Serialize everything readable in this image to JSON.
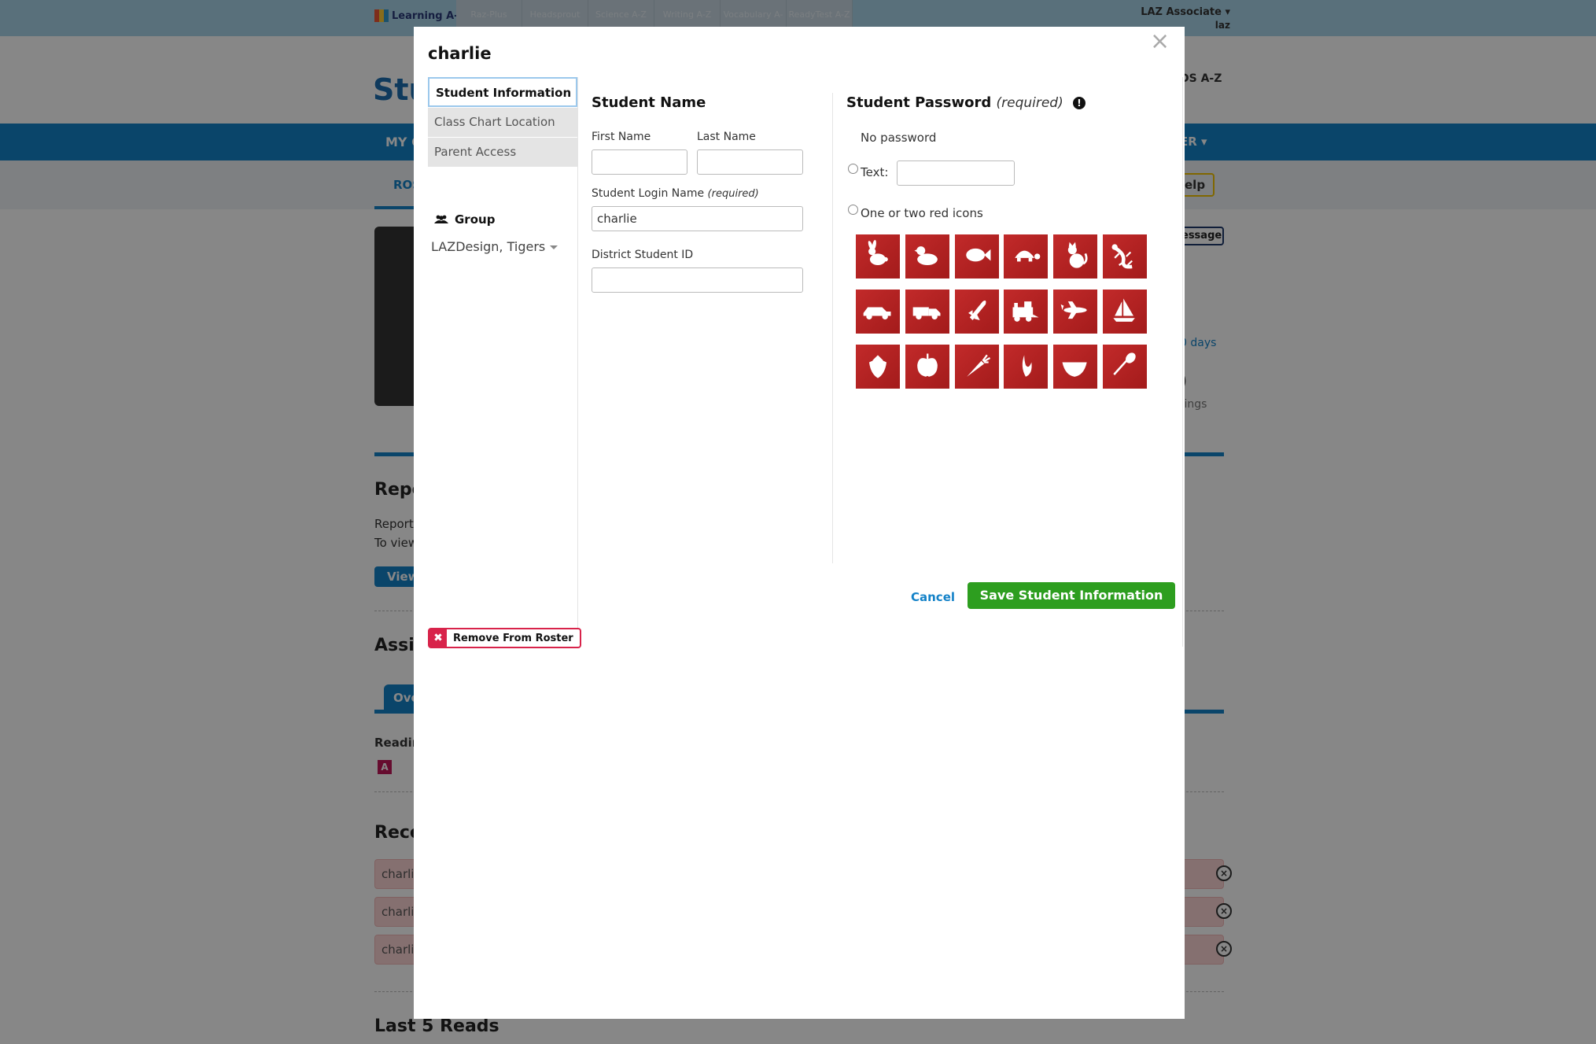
{
  "background": {
    "brand_logo": "Learning A-Z",
    "products": [
      "Raz-Plus",
      "Headsprout",
      "Science A-Z",
      "Writing A-Z",
      "Vocabulary A-Z",
      "ReadyTest A-Z"
    ],
    "user": {
      "name": "LAZ Associate",
      "sub": "laz"
    },
    "brand_partial": "Stu",
    "kids_partial": "DS A-Z",
    "nav_left_partial": "MY C",
    "nav_right_partial": "ER",
    "subnav_partial": "ROS",
    "help_partial": "elp",
    "message_partial": "essage",
    "stat_a_partial": "0 days",
    "stat_b_partial": ")",
    "stat_c_partial": "tings",
    "reports_title_partial": "Repo",
    "reports_text_1_partial": "Report",
    "reports_text_2_partial": "To view",
    "view_button_partial": "View",
    "assign_title_partial": "Assig",
    "overview_tab_partial": "Ove",
    "reading_label_partial": "Readir",
    "reading_level": "A",
    "recent_title_partial": "Rece",
    "recent_rows": [
      "charli",
      "charli",
      "charli"
    ],
    "last_reads_title": "Last 5 Reads"
  },
  "modal": {
    "title": "charlie",
    "close_label": "×",
    "tabs": [
      {
        "label": "Student Information",
        "active": true
      },
      {
        "label": "Class Chart Location",
        "active": false
      },
      {
        "label": "Parent Access",
        "active": false
      }
    ],
    "group": {
      "header": "Group",
      "value": "LAZDesign, Tigers"
    },
    "student_name": {
      "header": "Student Name",
      "first_name_label": "First Name",
      "first_name_value": "",
      "last_name_label": "Last Name",
      "last_name_value": "",
      "login_label": "Student Login Name",
      "login_required": "(required)",
      "login_value": "charlie",
      "district_id_label": "District Student ID",
      "district_id_value": ""
    },
    "password": {
      "header": "Student Password",
      "required": "(required)",
      "info_icon": "!",
      "no_password": "No password",
      "text_option": "Text:",
      "text_value": "",
      "icons_option": "One or two red icons",
      "icons": [
        "rabbit-icon",
        "duck-icon",
        "fish-icon",
        "turtle-icon",
        "cat-icon",
        "lizard-icon",
        "car-icon",
        "truck-icon",
        "rocket-icon",
        "train-icon",
        "airplane-icon",
        "sailboat-icon",
        "strawberry-icon",
        "apple-icon",
        "carrot-icon",
        "banana-icon",
        "watermelon-icon",
        "spoon-icon"
      ],
      "tile_color": "#b82222"
    },
    "cancel_label": "Cancel",
    "save_label": "Save Student Information",
    "remove_label": "Remove From Roster",
    "remove_icon": "✖"
  },
  "colors": {
    "accent_blue": "#1482c8",
    "save_green": "#2d9e1f",
    "remove_red": "#d8234a"
  }
}
